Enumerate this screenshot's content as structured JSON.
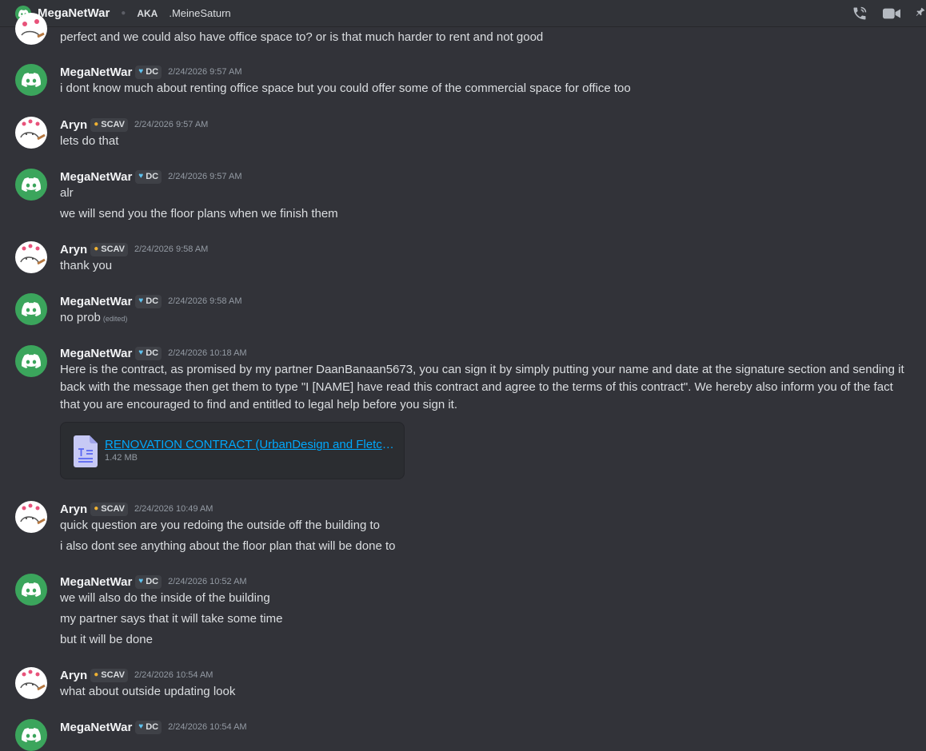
{
  "header": {
    "name": "MegaNetWar",
    "aka": "AKA",
    "alias": ".MeineSaturn"
  },
  "tags": {
    "dc": "DC",
    "scav": "SCAV"
  },
  "messages": {
    "m0": {
      "text": "perfect and we could also have office space to? or is that much harder to rent and not good"
    },
    "m1": {
      "author": "MegaNetWar",
      "time": "2/24/2026 9:57 AM",
      "lines": [
        "i dont know much about renting office space but you could offer some of the commercial space for office too"
      ]
    },
    "m2": {
      "author": "Aryn",
      "time": "2/24/2026 9:57 AM",
      "lines": [
        "lets do that"
      ]
    },
    "m3": {
      "author": "MegaNetWar",
      "time": "2/24/2026 9:57 AM",
      "lines": [
        "alr",
        "we will send you the floor plans when we finish them"
      ]
    },
    "m4": {
      "author": "Aryn",
      "time": "2/24/2026 9:58 AM",
      "lines": [
        "thank you"
      ]
    },
    "m5": {
      "author": "MegaNetWar",
      "time": "2/24/2026 9:58 AM",
      "lines": [
        "no prob"
      ],
      "edited": "(edited)"
    },
    "m6": {
      "author": "MegaNetWar",
      "time": "2/24/2026 10:18 AM",
      "lines": [
        "Here is the contract, as promised by my partner DaanBanaan5673, you can sign it by simply putting your name and date at the signature section and sending it back with the message then get them to type \"I [NAME] have read this contract and agree to the terms of this contract\". We hereby also inform you of the fact that you are encouraged to find and entitled to legal help before you sign it."
      ],
      "attachment": {
        "name": "RENOVATION CONTRACT (UrbanDesign and Fletch...",
        "size": "1.42 MB"
      }
    },
    "m7": {
      "author": "Aryn",
      "time": "2/24/2026 10:49 AM",
      "lines": [
        "quick question are you redoing the outside off the building to",
        "i also dont see anything about the floor plan that will be done to"
      ]
    },
    "m8": {
      "author": "MegaNetWar",
      "time": "2/24/2026 10:52 AM",
      "lines": [
        "we will also do the inside of the building",
        "my partner says that it will take some time",
        "but it will be done"
      ]
    },
    "m9": {
      "author": "Aryn",
      "time": "2/24/2026 10:54 AM",
      "lines": [
        "what about outside updating look"
      ]
    },
    "m10": {
      "author": "MegaNetWar",
      "time": "2/24/2026 10:54 AM",
      "lines": []
    }
  },
  "colors": {
    "background": "#323339",
    "discord_green": "#3ba55c",
    "link": "#00a8fc",
    "muted": "#949ba4"
  }
}
